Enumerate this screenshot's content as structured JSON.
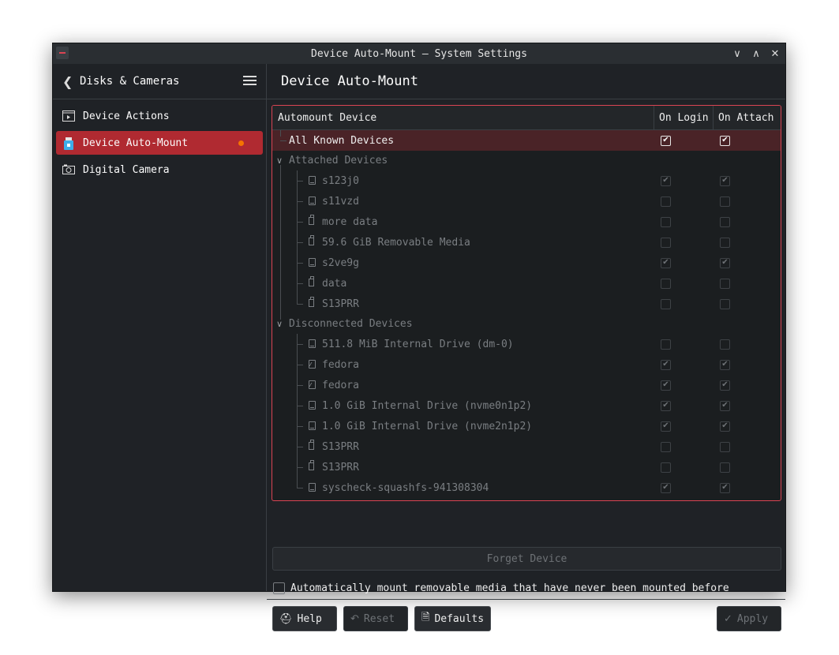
{
  "window": {
    "title": "Device Auto-Mount — System Settings"
  },
  "titlebar": {
    "minimize_glyph": "∨",
    "maximize_glyph": "∧",
    "close_glyph": "✕"
  },
  "sidebar": {
    "header": "Disks & Cameras",
    "items": [
      {
        "label": "Device Actions",
        "icon": "device-actions-icon",
        "active": false
      },
      {
        "label": "Device Auto-Mount",
        "icon": "usb-drive-icon",
        "active": true,
        "modified": true
      },
      {
        "label": "Digital Camera",
        "icon": "camera-icon",
        "active": false
      }
    ]
  },
  "main": {
    "title": "Device Auto-Mount",
    "table": {
      "headers": {
        "device": "Automount Device",
        "on_login": "On Login",
        "on_attach": "On Attach"
      },
      "all_known": {
        "label": "All Known Devices",
        "on_login": true,
        "on_attach": true
      },
      "groups": [
        {
          "label": "Attached Devices",
          "expanded": true,
          "devices": [
            {
              "label": "s123j0",
              "icon": "disk",
              "on_login": true,
              "on_attach": true
            },
            {
              "label": "s11vzd",
              "icon": "disk",
              "on_login": false,
              "on_attach": false
            },
            {
              "label": "more data",
              "icon": "usb",
              "on_login": false,
              "on_attach": false
            },
            {
              "label": "59.6 GiB Removable Media",
              "icon": "usb",
              "on_login": false,
              "on_attach": false
            },
            {
              "label": "s2ve9g",
              "icon": "disk",
              "on_login": true,
              "on_attach": true
            },
            {
              "label": "data",
              "icon": "usb",
              "on_login": false,
              "on_attach": false
            },
            {
              "label": "S13PRR",
              "icon": "usb",
              "on_login": false,
              "on_attach": false
            }
          ]
        },
        {
          "label": "Disconnected Devices",
          "expanded": true,
          "devices": [
            {
              "label": "511.8 MiB Internal Drive (dm-0)",
              "icon": "disk",
              "on_login": false,
              "on_attach": false
            },
            {
              "label": "fedora",
              "icon": "img",
              "on_login": true,
              "on_attach": true
            },
            {
              "label": "fedora",
              "icon": "img",
              "on_login": true,
              "on_attach": true
            },
            {
              "label": "1.0 GiB Internal Drive (nvme0n1p2)",
              "icon": "disk",
              "on_login": true,
              "on_attach": true
            },
            {
              "label": "1.0 GiB Internal Drive (nvme2n1p2)",
              "icon": "disk",
              "on_login": true,
              "on_attach": true
            },
            {
              "label": "S13PRR",
              "icon": "usb",
              "on_login": false,
              "on_attach": false
            },
            {
              "label": "S13PRR",
              "icon": "usb",
              "on_login": false,
              "on_attach": false
            },
            {
              "label": "syscheck-squashfs-941308304",
              "icon": "disk",
              "on_login": true,
              "on_attach": true
            }
          ]
        }
      ]
    },
    "forget_button": "Forget Device",
    "auto_mount_new": {
      "label": "Automatically mount removable media that have never been mounted before",
      "checked": false
    }
  },
  "footer": {
    "help": "Help",
    "reset": "Reset",
    "defaults": "Defaults",
    "apply": "Apply"
  },
  "colors": {
    "accent": "#da4453",
    "selection": "#b02a31",
    "modified_dot": "#f67400",
    "background": "#1f2226"
  }
}
